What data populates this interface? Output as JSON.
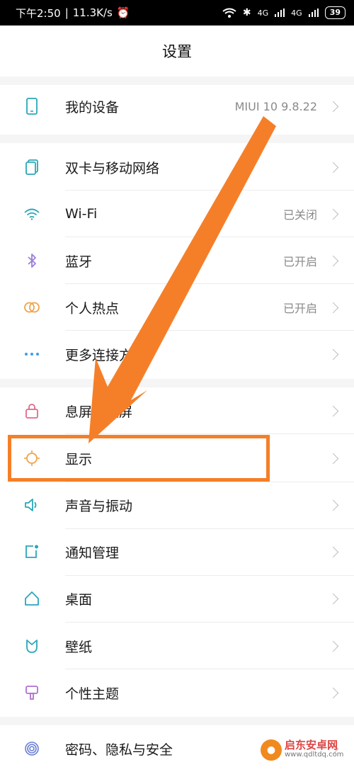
{
  "status_bar": {
    "time": "下午2:50",
    "speed": "11.3K/s",
    "net1": "4G",
    "net2": "4G",
    "battery": "39"
  },
  "header": {
    "title": "设置"
  },
  "rows": {
    "device": {
      "label": "我的设备",
      "value": "MIUI 10 9.8.22"
    },
    "sim": {
      "label": "双卡与移动网络"
    },
    "wifi": {
      "label": "Wi-Fi",
      "value": "已关闭"
    },
    "bluetooth": {
      "label": "蓝牙",
      "value": "已开启"
    },
    "hotspot": {
      "label": "个人热点",
      "value": "已开启"
    },
    "more": {
      "label": "更多连接方式"
    },
    "lock": {
      "label": "息屏与锁屏"
    },
    "display": {
      "label": "显示"
    },
    "sound": {
      "label": "声音与振动"
    },
    "notify": {
      "label": "通知管理"
    },
    "desktop": {
      "label": "桌面"
    },
    "wallpaper": {
      "label": "壁纸"
    },
    "theme": {
      "label": "个性主题"
    },
    "privacy": {
      "label": "密码、隐私与安全"
    }
  },
  "watermark": {
    "line1": "启东安卓网",
    "line2": "www.qdltdq.com"
  },
  "colors": {
    "annotation": "#f57f28",
    "icon_teal": "#2aa7b8",
    "icon_purple": "#9b7fd6",
    "icon_orange": "#f0a24a",
    "icon_pink": "#e06a8a",
    "icon_blue": "#3d9ce6"
  }
}
